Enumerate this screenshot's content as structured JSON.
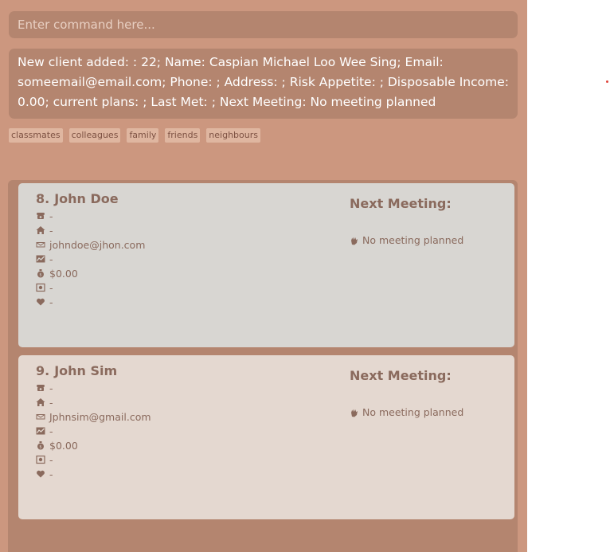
{
  "command": {
    "placeholder": "Enter command here...",
    "value": ""
  },
  "result": "New client added: : 22; Name: Caspian Michael Loo Wee Sing; Email: someemail@email.com; Phone: ; Address: ; Risk Appetite: ; Disposable Income: 0.00; current plans: ; Last Met: ; Next Meeting: No meeting planned",
  "tags": [
    "classmates",
    "colleagues",
    "family",
    "friends",
    "neighbours"
  ],
  "clients": [
    {
      "index": "8.",
      "name": "John Doe",
      "phone": "-",
      "address": "-",
      "email": "johndoe@jhon.com",
      "risk": "-",
      "income": "$0.00",
      "plans": "-",
      "lastMet": "-",
      "meetingTitle": "Next Meeting:",
      "meetingStatus": "No meeting planned"
    },
    {
      "index": "9.",
      "name": "John Sim",
      "phone": "-",
      "address": "-",
      "email": "Jphnsim@gmail.com",
      "risk": "-",
      "income": "$0.00",
      "plans": "-",
      "lastMet": "-",
      "meetingTitle": "Next Meeting:",
      "meetingStatus": "No meeting planned"
    }
  ],
  "colors": {
    "background": "#cc977f",
    "panel": "#b4856f",
    "card_selected": "#d8d6d2",
    "card": "#e4d8d0",
    "text": "#8a6a5d"
  }
}
